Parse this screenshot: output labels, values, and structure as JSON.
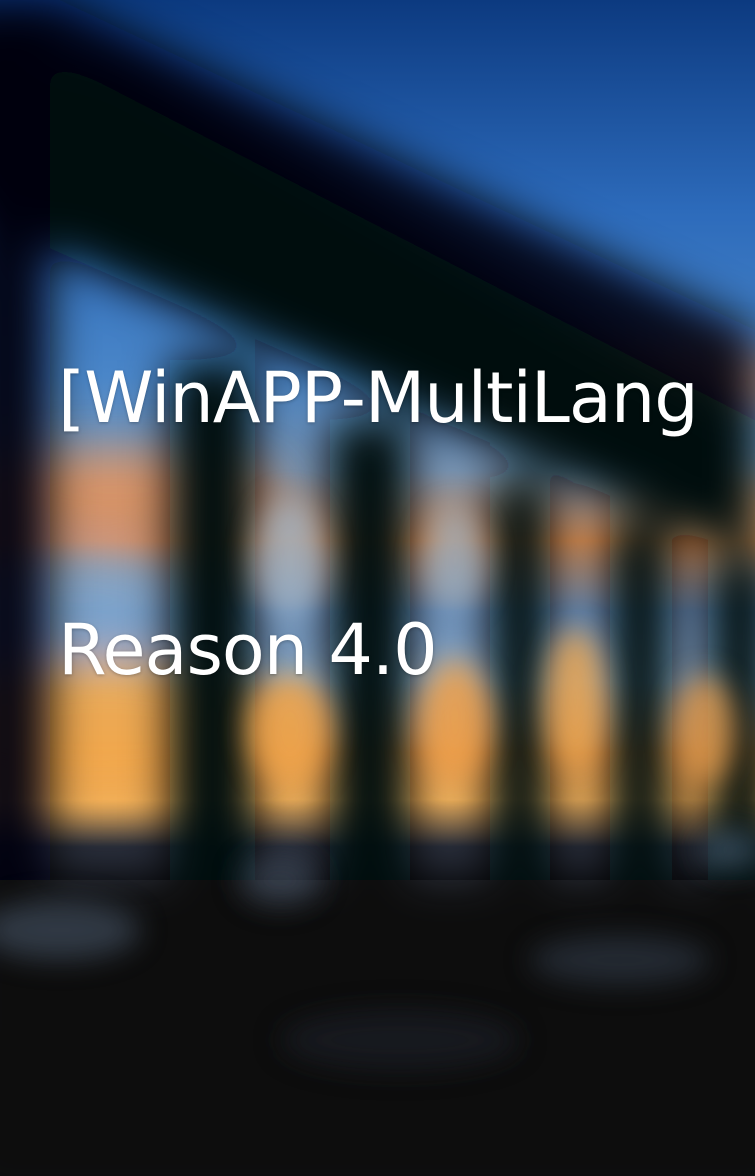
{
  "cover": {
    "title_line1": "[WinAPP-MultiLang",
    "title_line2": "Reason 4.0"
  },
  "colors": {
    "sky_top": "#0e3f86",
    "sky_mid": "#3d7fc9",
    "sunset_orange": "#e08a3e",
    "bridge_silhouette": "#07080c",
    "title_text": "#ffffff"
  }
}
